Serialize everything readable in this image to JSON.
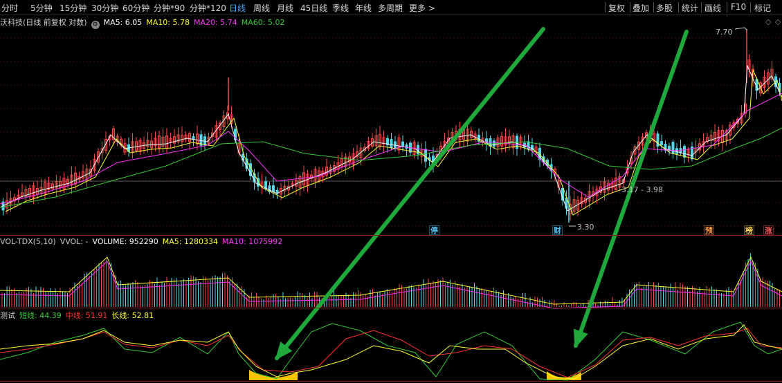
{
  "toolbar": {
    "periods": [
      {
        "label": "分时",
        "active": false
      },
      {
        "label": "5分钟",
        "active": false
      },
      {
        "label": "15分钟",
        "active": false
      },
      {
        "label": "30分钟",
        "active": false
      },
      {
        "label": "60分钟",
        "active": false
      },
      {
        "label": "分钟*90",
        "active": false
      },
      {
        "label": "分钟*120",
        "active": false
      },
      {
        "label": "日线",
        "active": true
      },
      {
        "label": "周线",
        "active": false
      },
      {
        "label": "月线",
        "active": false
      },
      {
        "label": "45日线",
        "active": false
      },
      {
        "label": "季线",
        "active": false
      },
      {
        "label": "年线",
        "active": false
      },
      {
        "label": "多周期",
        "active": false
      },
      {
        "label": "更多 >",
        "active": false
      }
    ],
    "tools": [
      "复权",
      "叠加",
      "多股",
      "统计",
      "画线",
      "F10",
      "标记"
    ]
  },
  "main_chart": {
    "title": "沃科技(日线 前复权 对数)",
    "ma5_label": "MA5: 6.05",
    "ma10_label": "MA10: 5.78",
    "ma20_label": "MA20: 5.74",
    "ma60_label": "MA60: 5.02",
    "high_label": "7.70",
    "low_label": "3.30",
    "range_label": "3.17 - 3.98",
    "badges": [
      {
        "text": "停",
        "color": "#4fc3f7"
      },
      {
        "text": "财",
        "color": "#4fc3f7"
      },
      {
        "text": "预",
        "color": "#ff9a3c"
      },
      {
        "text": "榜",
        "color": "#ffd54f"
      },
      {
        "text": "涨",
        "color": "#ff5a5a"
      }
    ]
  },
  "volume_panel": {
    "title": "VOL-TDX(5,10)",
    "vvol_label": "VVOL: -",
    "volume_label": "VOLUME: 952290",
    "ma5_label": "MA5: 1280334",
    "ma10_label": "MA10: 1075992"
  },
  "indicator_panel": {
    "title": "测试",
    "short_label": "短线: 44.39",
    "mid_label": "中线: 51.91",
    "long_label": "长线: 52.81"
  },
  "colors": {
    "up": "#ff4a4a",
    "down": "#54d6e8",
    "ma5": "#ffffff",
    "ma10": "#ffff33",
    "ma20": "#ff33ff",
    "ma60": "#33cc33",
    "arrow": "#1fa83c",
    "fill": "#ffc400"
  }
}
